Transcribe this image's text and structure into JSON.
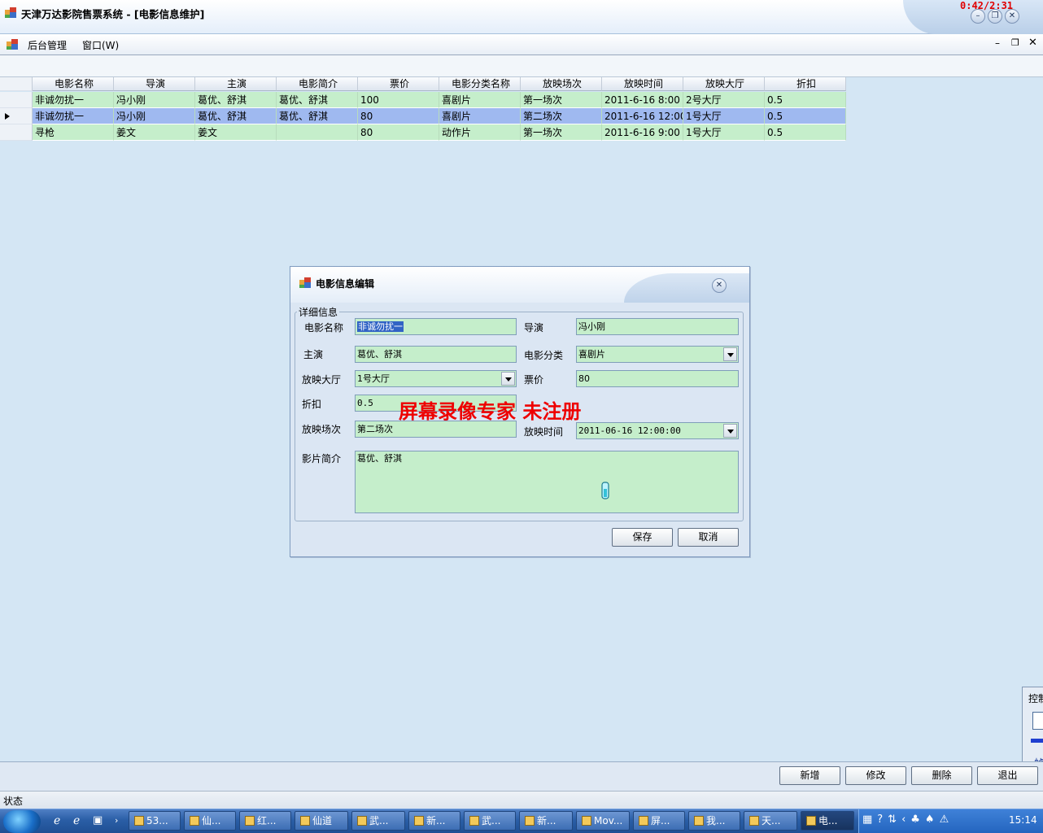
{
  "window": {
    "title": "天津万达影院售票系统 - [电影信息维护]",
    "recorder_time": "0:42/2:31"
  },
  "menu": {
    "items": [
      "后台管理",
      "窗口(W)"
    ]
  },
  "grid": {
    "columns": [
      "电影名称",
      "导演",
      "主演",
      "电影简介",
      "票价",
      "电影分类名称",
      "放映场次",
      "放映时间",
      "放映大厅",
      "折扣"
    ],
    "rows": [
      [
        "非诚勿扰一",
        "冯小刚",
        "葛优、舒淇",
        "葛优、舒淇",
        "100",
        "喜剧片",
        "第一场次",
        "2011-6-16 8:00",
        "2号大厅",
        "0.5"
      ],
      [
        "非诚勿扰一",
        "冯小刚",
        "葛优、舒淇",
        "葛优、舒淇",
        "80",
        "喜剧片",
        "第二场次",
        "2011-6-16 12:00",
        "1号大厅",
        "0.5"
      ],
      [
        "寻枪",
        "姜文",
        "姜文",
        "",
        "80",
        "动作片",
        "第一场次",
        "2011-6-16 9:00",
        "1号大厅",
        "0.5"
      ]
    ],
    "selected_row": 1
  },
  "dialog": {
    "title": "电影信息编辑",
    "group_label": "详细信息",
    "labels": {
      "name": "电影名称",
      "director": "导演",
      "actors": "主演",
      "category": "电影分类",
      "hall": "放映大厅",
      "price": "票价",
      "discount": "折扣",
      "session": "放映场次",
      "show_time": "放映时间",
      "intro": "影片简介"
    },
    "values": {
      "name": "非诚勿扰一",
      "director": "冯小刚",
      "actors": "葛优、舒淇",
      "category": "喜剧片",
      "hall": "1号大厅",
      "price": "80",
      "discount": "0.5",
      "session": "第二场次",
      "show_time": "2011-06-16 12:00:00",
      "intro": "葛优、舒淇"
    },
    "buttons": {
      "save": "保存",
      "cancel": "取消"
    }
  },
  "watermark": "屏幕录像专家  未注册",
  "actions": {
    "add": "新增",
    "edit": "修改",
    "delete": "删除",
    "exit": "退出"
  },
  "status": "状态",
  "side_panel": {
    "title": "控制",
    "label": "帧"
  },
  "taskbar": {
    "items": [
      "53...",
      "仙...",
      "红...",
      "仙道",
      "武...",
      "新...",
      "武...",
      "新...",
      "Mov...",
      "屏...",
      "我...",
      "天...",
      "电..."
    ],
    "active_index": 12,
    "clock": "15:14"
  }
}
